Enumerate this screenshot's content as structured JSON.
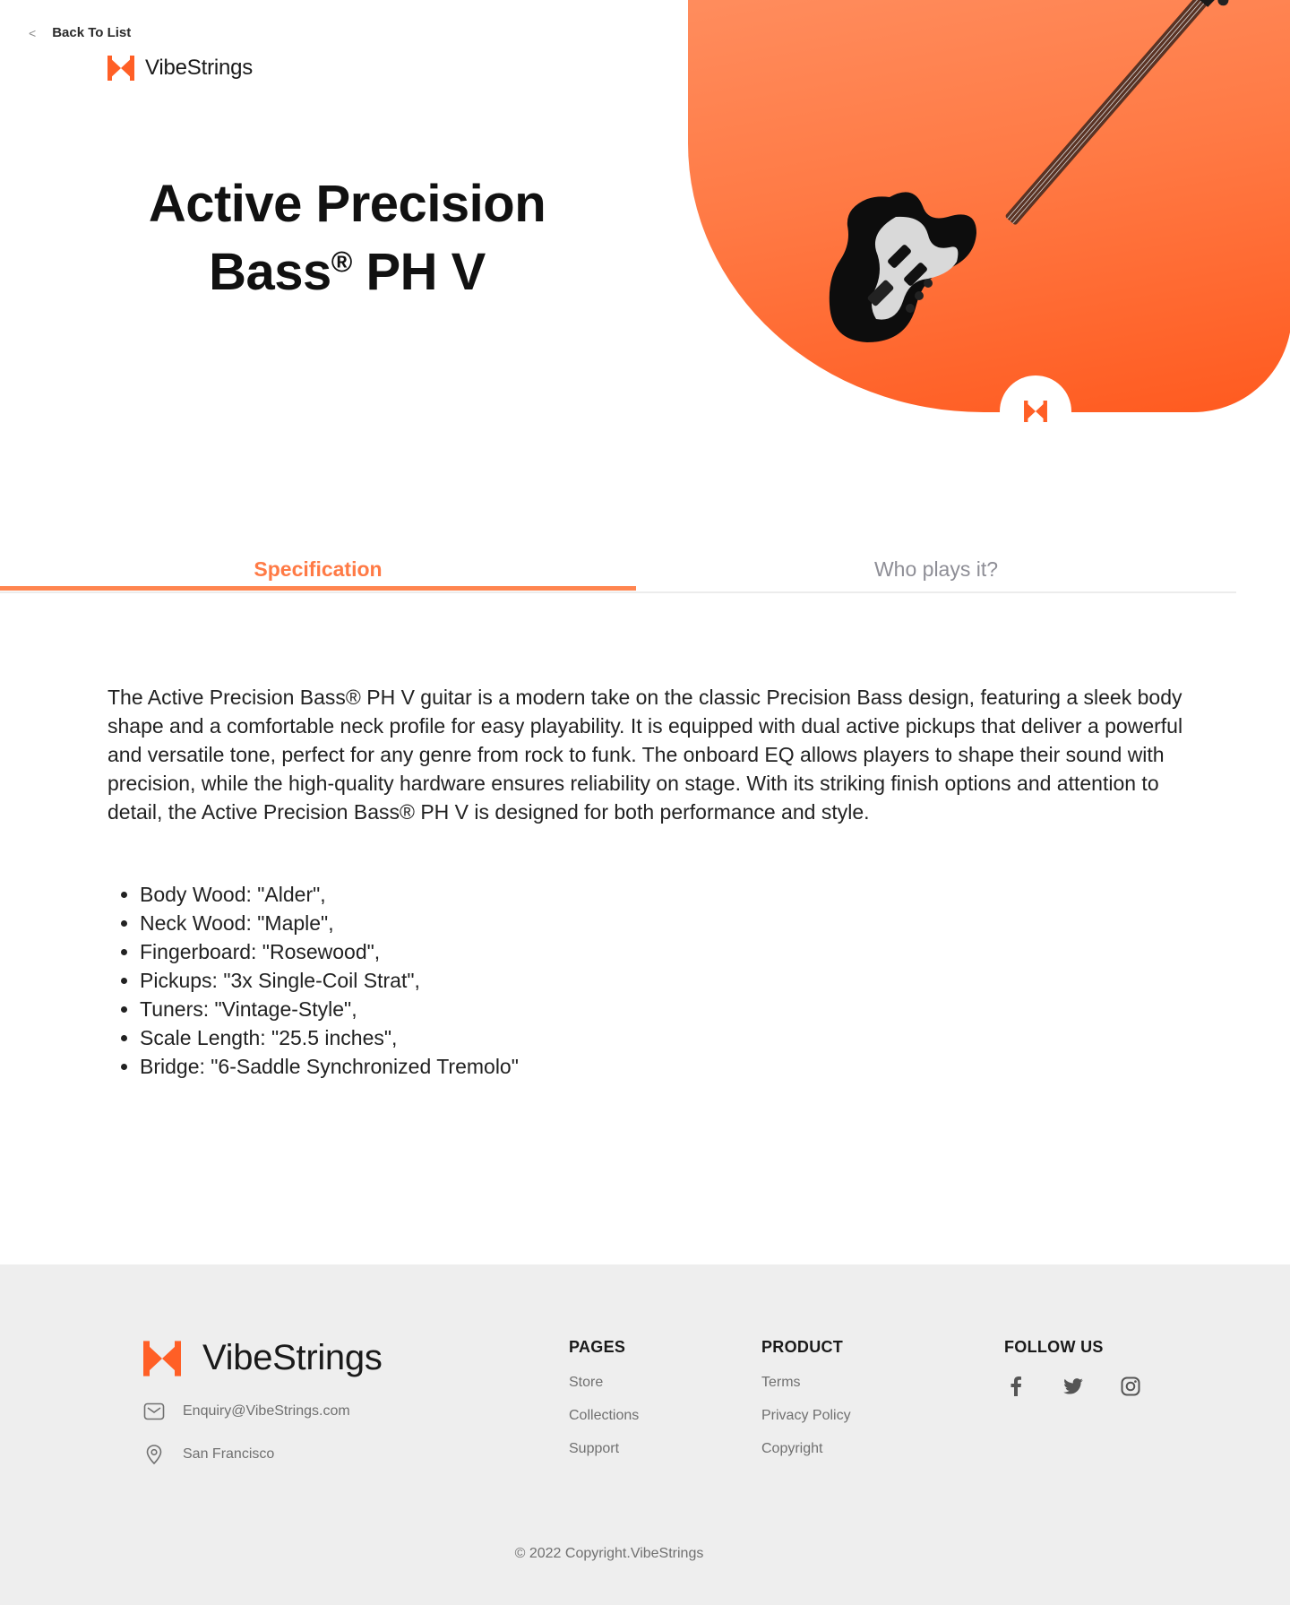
{
  "nav": {
    "back_label": "Back To List",
    "back_icon": "chevron-left"
  },
  "brand": {
    "name": "VibeStrings",
    "accent": "#ff5f26"
  },
  "product": {
    "title_line1": "Active Precision",
    "title_line2": "Bass",
    "title_reg": "®",
    "title_suffix": " PH V"
  },
  "tabs": [
    {
      "label": "Specification",
      "active": true
    },
    {
      "label": "Who plays it?",
      "active": false
    }
  ],
  "description": "The Active Precision Bass® PH V guitar is a modern take on the classic Precision Bass design, featuring a sleek body shape and a comfortable neck profile for easy playability. It is equipped with dual active pickups that deliver a powerful and versatile tone, perfect for any genre from rock to funk. The onboard EQ allows players to shape their sound with precision, while the high-quality hardware ensures reliability on stage. With its striking finish options and attention to detail, the Active Precision Bass® PH V is designed for both performance and style.",
  "specs": [
    "Body Wood: \"Alder\",",
    "Neck Wood: \"Maple\",",
    "Fingerboard: \"Rosewood\",",
    "Pickups: \"3x Single-Coil Strat\",",
    "Tuners: \"Vintage-Style\",",
    "Scale Length: \"25.5 inches\",",
    "Bridge: \"6-Saddle Synchronized Tremolo\""
  ],
  "footer": {
    "brand": "VibeStrings",
    "email": "Enquiry@VibeStrings.com",
    "location": "San Francisco",
    "pages_heading": "PAGES",
    "pages": [
      "Store",
      "Collections",
      "Support"
    ],
    "product_heading": "PRODUCT",
    "product_links": [
      "Terms",
      "Privacy Policy",
      "Copyright"
    ],
    "follow_heading": "FOLLOW US",
    "socials": [
      "facebook-icon",
      "twitter-icon",
      "instagram-icon"
    ],
    "copyright": "© 2022 Copyright.VibeStrings"
  }
}
